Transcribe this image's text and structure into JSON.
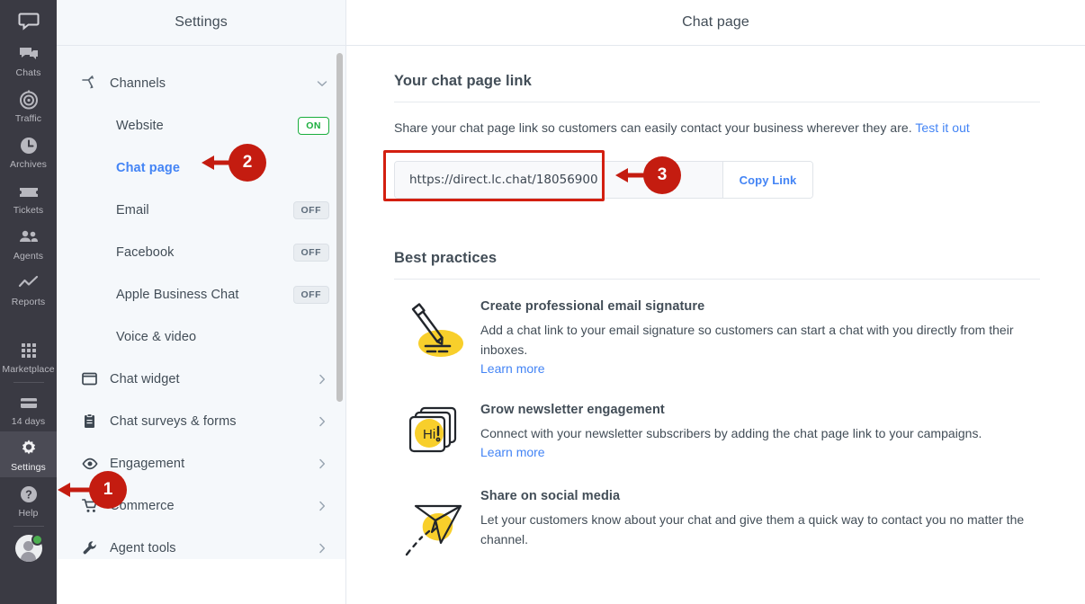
{
  "rail": {
    "top_icon": "speech-bubble-icon",
    "items": [
      {
        "label": "Chats",
        "icon": "chats-icon",
        "active": false
      },
      {
        "label": "Traffic",
        "icon": "traffic-icon",
        "active": false
      },
      {
        "label": "Archives",
        "icon": "clock-icon",
        "active": false
      },
      {
        "label": "Tickets",
        "icon": "ticket-icon",
        "active": false
      },
      {
        "label": "Agents",
        "icon": "agents-icon",
        "active": false
      },
      {
        "label": "Reports",
        "icon": "reports-icon",
        "active": false
      },
      {
        "label": "Marketplace",
        "icon": "grid-icon",
        "active": false
      },
      {
        "label": "14 days",
        "icon": "credit-card-icon",
        "active": false
      },
      {
        "label": "Settings",
        "icon": "gear-icon",
        "active": true
      },
      {
        "label": "Help",
        "icon": "help-icon",
        "active": false
      }
    ],
    "avatar": "user-avatar",
    "status": "online"
  },
  "settings": {
    "title": "Settings",
    "group": {
      "label": "Channels",
      "icon": "branch-icon",
      "expanded": true,
      "chevron": "chevron-down-icon"
    },
    "channels": [
      {
        "label": "Website",
        "badge": "ON",
        "state": "on",
        "selected": false
      },
      {
        "label": "Chat page",
        "badge": "",
        "state": "none",
        "selected": true
      },
      {
        "label": "Email",
        "badge": "OFF",
        "state": "off",
        "selected": false
      },
      {
        "label": "Facebook",
        "badge": "OFF",
        "state": "off",
        "selected": false
      },
      {
        "label": "Apple Business Chat",
        "badge": "OFF",
        "state": "off",
        "selected": false
      },
      {
        "label": "Voice & video",
        "badge": "",
        "state": "none",
        "selected": false
      }
    ],
    "sections": [
      {
        "label": "Chat widget",
        "icon": "window-icon",
        "chevron": "chevron-right-icon"
      },
      {
        "label": "Chat surveys & forms",
        "icon": "clipboard-icon",
        "chevron": "chevron-right-icon"
      },
      {
        "label": "Engagement",
        "icon": "eye-icon",
        "chevron": "chevron-right-icon"
      },
      {
        "label": "Commerce",
        "icon": "cart-icon",
        "chevron": "chevron-right-icon"
      },
      {
        "label": "Agent tools",
        "icon": "wrench-icon",
        "chevron": "chevron-right-icon"
      }
    ]
  },
  "main": {
    "title": "Chat page",
    "link_section": {
      "heading": "Your chat page link",
      "description": "Share your chat page link so customers can easily contact your business wherever they are.",
      "test_link": "Test it out",
      "url_value": "https://direct.lc.chat/18056900",
      "url_placeholder": "https://direct.lc.chat/",
      "copy_label": "Copy Link"
    },
    "best_practices": {
      "heading": "Best practices",
      "items": [
        {
          "icon": "pencil-illustration",
          "title": "Create professional email signature",
          "body": "Add a chat link to your email signature so customers can start a chat with you directly from their inboxes.",
          "link": "Learn more"
        },
        {
          "icon": "newsletter-cards-illustration",
          "title": "Grow newsletter engagement",
          "body": "Connect with your newsletter subscribers by adding the chat page link to your campaigns.",
          "link": "Learn more"
        },
        {
          "icon": "paper-plane-illustration",
          "title": "Share on social media",
          "body": "Let your customers know about your chat and give them a quick way to contact you no matter the channel.",
          "link": ""
        }
      ]
    }
  },
  "annotations": {
    "color": "#c41c10",
    "steps": [
      {
        "number": "1",
        "target": "settings-rail-item"
      },
      {
        "number": "2",
        "target": "chat-page-nav-item"
      },
      {
        "number": "3",
        "target": "chat-page-url-field"
      }
    ]
  },
  "colors": {
    "rail_bg": "#3a3a43",
    "panel_bg": "#f5f8fb",
    "accent_blue": "#4384f5",
    "on_green": "#1aae3d",
    "annotation_red": "#c41c10",
    "illustration_yellow": "#f8cf2b"
  }
}
